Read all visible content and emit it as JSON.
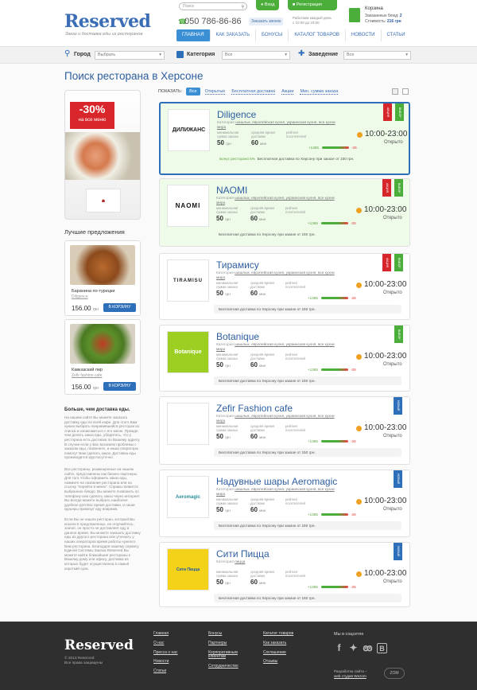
{
  "header": {
    "logo": "Reserved",
    "tagline": "Заказ и доставка еды из ресторанов",
    "search_placeholder": "Поиск",
    "login": "Вход",
    "register": "Регистрация",
    "phone": "050 786-86-86",
    "order_call": "Заказать звонок",
    "hours": [
      "Работаем каждый день",
      "с 10:00 до 23:00"
    ],
    "cart": {
      "title": "Корзина",
      "items_label": "Заказанных блюд:",
      "items_value": "2",
      "cost_label": "Стоимость:",
      "cost_value": "216 грн"
    },
    "nav": [
      "ГЛАВНАЯ",
      "КАК ЗАКАЗАТЬ",
      "БОНУСЫ",
      "КАТАЛОГ ТОВАРОВ",
      "НОВОСТИ",
      "СТАТЬИ"
    ]
  },
  "filters": {
    "city_label": "Город",
    "city_value": "Выбрать",
    "category_label": "Категория",
    "category_value": "Все",
    "place_label": "Заведение",
    "place_value": "Все"
  },
  "page_title": "Поиск ресторана в Херсоне",
  "promo": {
    "percent": "-30%",
    "text": "на все меню"
  },
  "best_offers_title": "Лучшие предложения",
  "offers": [
    {
      "name": "Баранина по-турецки",
      "restaurant": "Diligence",
      "price": "156.00",
      "currency": "грн",
      "button": "В КОРЗИНУ"
    },
    {
      "name": "Кавказский пир",
      "restaurant": "Zefir fashion cafe",
      "price": "156.00",
      "currency": "грн",
      "button": "В КОРЗИНУ"
    }
  ],
  "article": {
    "title": "Больше, чем доставка еды.",
    "p1": "На нашем сайте Вы можете заказать доставку еды по всей кафе. Для этого Вам нужно выбрать понравившийся ресторан из списка и ознакомиться с его меню. Прежде чем делать заказ еды, убедитесь, что у ресторана есть доставка по Вашему адресу. В случае если у Вас возникли проблемы с заказом еды, позвоните, и наши операторы помогут Вам сделать заказ. Доставка еды производится круглосуточно.",
    "p2": "Все рестораны, размещенные на нашем сайте, представлены как бизнес-партнеры. Для того чтобы оформить заказ еды, нажмите на название ресторана или на ссылку \"перейти в меню\". Справа появится выбранное блюдо. Вы можете позвонить по телефону или сделать заказ через интернет. Вы всегда можете выбрать наиболее удобное для Вас время доставки, и наши курьеры привезут еду вовремя.",
    "p3": "Если Вы не нашли ресторан, который Вы искали в предложенных, не огорчайтесь, значит, он просто не доставляет еду в данное время. Вы можете заказать доставку еды из другого ресторана или уточнить у наших операторов время работы нужного Вам ресторана. Благодаря нашему сервису Единой Системы Заказа Reserved Вы можете найти ближайшие рестораны к Вашему дому или офису, доставка из которых будет осуществлена в самый короткий срок."
  },
  "show_bar": {
    "label": "ПОКАЗАТЬ:",
    "options": [
      "Все",
      "Открытые",
      "Бесплатная доставка",
      "Акции",
      "Мин. сумма заказа"
    ]
  },
  "labels": {
    "categories": "Категория",
    "min_sum": [
      "минимальная",
      "сумма заказа"
    ],
    "avg_time": [
      "средняя время",
      "доставки"
    ],
    "rating": [
      "рейтинг",
      "посетителей"
    ],
    "sum_unit": "грн",
    "time_unit": "мин",
    "rate_pos": "+1365",
    "rate_neg": "-26"
  },
  "restaurants": [
    {
      "name": "Diligence",
      "logo": "ДИЛИЖАНС",
      "categories": "шашлык, европейская кухня, украинская кухня, все кухни мира",
      "min_sum": "50",
      "avg_time": "60",
      "time": "10:00-23:00",
      "status": "Открыто",
      "bonus": "Бонус ресторана 5%",
      "delivery": "Бесплатная доставка по Херсону при заказе от 150 грн.",
      "ribbon": "АКЦИЯ",
      "ribbon2": "ВЫБОР",
      "style": "hl"
    },
    {
      "name": "NAOMI",
      "logo": "NAOMI",
      "categories": "шашлык, европейская кухня, украинская кухня, все кухни мира",
      "min_sum": "50",
      "avg_time": "60",
      "time": "10:00-23:00",
      "status": "Открыто",
      "bonus": "",
      "delivery": "Бесплатная доставка по Херсону при заказе от 150 грн.",
      "ribbon": "АКЦИЯ",
      "ribbon2": "ВЫБОР",
      "style": "gr"
    },
    {
      "name": "Тирамису",
      "logo": "TIRAMISU",
      "categories": "шашлык, европейская кухня, украинская кухня, все кухни мира",
      "min_sum": "50",
      "avg_time": "60",
      "time": "10:00-23:00",
      "status": "Открыто",
      "bonus": "",
      "delivery": "Бесплатная доставка по Херсону при заказе от 150 грн.",
      "ribbon": "АКЦИЯ",
      "ribbon2": "ВЫБОР",
      "style": ""
    },
    {
      "name": "Botanique",
      "logo": "Botanique",
      "categories": "шашлык, европейская кухня, украинская кухня, все кухни мира",
      "min_sum": "50",
      "avg_time": "60",
      "time": "10:00-23:00",
      "status": "Открыто",
      "bonus": "",
      "delivery": "Бесплатная доставка по Херсону при заказе от 150 грн.",
      "ribbon": "",
      "ribbon2": "ВЫБОР",
      "style": ""
    },
    {
      "name": "Zefir Fashion cafe",
      "logo": "",
      "categories": "шашлык, европейская кухня, украинская кухня, все кухни мира",
      "min_sum": "50",
      "avg_time": "60",
      "time": "10:00-23:00",
      "status": "Открыто",
      "bonus": "",
      "delivery": "Бесплатная доставка по Херсону при заказе от 150 грн.",
      "ribbon": "",
      "ribbon2": "НОВЫЙ",
      "style": ""
    },
    {
      "name": "Надувные шары Aeromagic",
      "logo": "Aeromagic",
      "categories": "шашлык, европейская кухня, украинская кухня, все кухни мира",
      "min_sum": "50",
      "avg_time": "60",
      "time": "10:00-23:00",
      "status": "Открыто",
      "bonus": "",
      "delivery": "Бесплатная доставка по Херсону при заказе от 150 грн.",
      "ribbon": "",
      "ribbon2": "НОВЫЙ",
      "style": ""
    },
    {
      "name": "Сити Пицца",
      "logo": "Сити Пицца",
      "categories": "пицца",
      "min_sum": "50",
      "avg_time": "60",
      "time": "10:00-23:00",
      "status": "Открыто",
      "bonus": "",
      "delivery": "Бесплатная доставка по Херсону при заказе от 150 грн.",
      "ribbon": "",
      "ribbon2": "НОВЫЙ",
      "style": ""
    }
  ],
  "footer": {
    "logo": "Reserved",
    "copy": [
      "© 2013 Reserved",
      "Все права защищены"
    ],
    "col1": [
      "Главная",
      "О нас",
      "Пресса о нас",
      "Новости",
      "Статьи"
    ],
    "col2": [
      "Бонусы",
      "Партнеры",
      "Корпоративным клиентам",
      "Сотрудничество"
    ],
    "col3": [
      "Каталог товаров",
      "Как заказать",
      "Соглашение",
      "Отзывы"
    ],
    "social_title": "Мы в соцсетях",
    "dev_text": "Разработка сайта –",
    "dev_link": "web студия Wezom"
  }
}
